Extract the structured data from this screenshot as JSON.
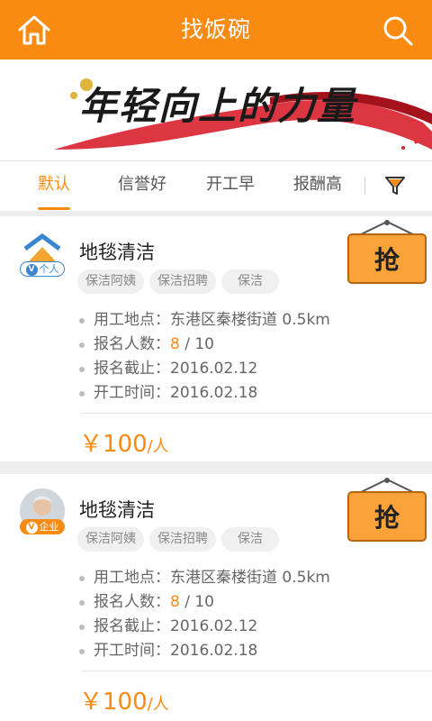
{
  "header": {
    "title": "找饭碗",
    "home_icon": "home-icon",
    "search_icon": "search-icon"
  },
  "banner": {
    "slogan": "年轻向上的力量"
  },
  "tabs": [
    {
      "label": "默认"
    },
    {
      "label": "信誉好"
    },
    {
      "label": "开工早"
    },
    {
      "label": "报酬高"
    }
  ],
  "filter_icon": "filter-icon",
  "labels": {
    "location": "用工地点：",
    "signup": "报名人数：",
    "deadline": "报名截止：",
    "start": "开工时间：",
    "grab": "抢"
  },
  "jobs": [
    {
      "title": "地毯清洁",
      "poster_type": "个人",
      "tags": [
        "保洁阿姨",
        "保洁招聘",
        "保洁"
      ],
      "location": "东港区秦楼街道",
      "distance": "0.5km",
      "signed": "8",
      "capacity": "/ 10",
      "deadline": "2016.02.12",
      "start_date": "2016.02.18",
      "price": "￥100",
      "price_unit": "/人"
    },
    {
      "title": "地毯清洁",
      "poster_type": "企业",
      "tags": [
        "保洁阿姨",
        "保洁招聘",
        "保洁"
      ],
      "location": "东港区秦楼街道",
      "distance": "0.5km",
      "signed": "8",
      "capacity": "/ 10",
      "deadline": "2016.02.12",
      "start_date": "2016.02.18",
      "price": "￥100",
      "price_unit": "/人"
    }
  ],
  "colors": {
    "accent": "#f98a12",
    "personal_badge": "#3a85d0"
  }
}
